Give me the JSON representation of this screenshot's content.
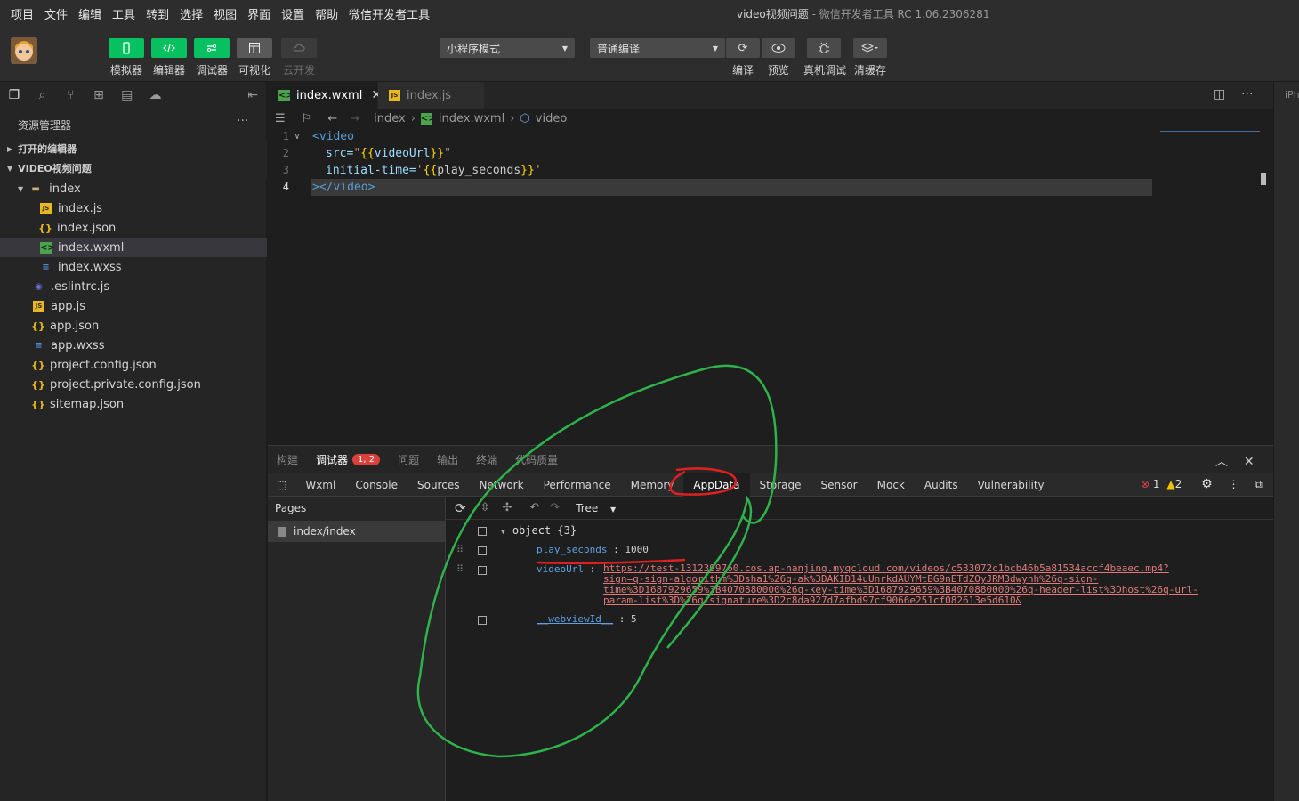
{
  "menu": [
    "项目",
    "文件",
    "编辑",
    "工具",
    "转到",
    "选择",
    "视图",
    "界面",
    "设置",
    "帮助",
    "微信开发者工具"
  ],
  "window_title": {
    "main": "video视频问题",
    "suffix": " - 微信开发者工具 RC 1.06.2306281"
  },
  "toolbar": {
    "simulator": "模拟器",
    "editor": "编辑器",
    "debugger": "调试器",
    "visual": "可视化",
    "cloud": "云开发",
    "mode_select": "小程序模式",
    "compile_select": "普通编译",
    "compile": "编译",
    "preview": "预览",
    "remote_debug": "真机调试",
    "clear_cache": "清缓存"
  },
  "sidebar": {
    "title": "资源管理器",
    "open_editors": "打开的编辑器",
    "project": "VIDEO视频问题",
    "files": [
      {
        "name": "index",
        "type": "folder"
      },
      {
        "name": "index.js",
        "type": "js"
      },
      {
        "name": "index.json",
        "type": "json"
      },
      {
        "name": "index.wxml",
        "type": "wxml"
      },
      {
        "name": "index.wxss",
        "type": "wxss"
      },
      {
        "name": ".eslintrc.js",
        "type": "lint"
      },
      {
        "name": "app.js",
        "type": "js"
      },
      {
        "name": "app.json",
        "type": "json"
      },
      {
        "name": "app.wxss",
        "type": "wxss"
      },
      {
        "name": "project.config.json",
        "type": "json"
      },
      {
        "name": "project.private.config.json",
        "type": "json"
      },
      {
        "name": "sitemap.json",
        "type": "json"
      }
    ]
  },
  "tabs": [
    {
      "label": "index.wxml",
      "active": true
    },
    {
      "label": "index.js",
      "active": false
    }
  ],
  "right_strip": "iPho",
  "breadcrumb": [
    "index",
    "index.wxml",
    "video"
  ],
  "code": {
    "line_numbers": [
      "1",
      "2",
      "3",
      "4"
    ],
    "l1_tag": "<video",
    "l2_attr": "src=",
    "l2_q1": "\"",
    "l2_open": "{{",
    "l2_var": "videoUrl",
    "l2_close": "}}",
    "l2_q2": "\"",
    "l3_attr": "initial-time=",
    "l3_q1": "'",
    "l3_open": "{{",
    "l3_var": "play_seconds",
    "l3_close": "}}",
    "l3_q2": "'",
    "l4_gt": ">",
    "l4_close": "</video>"
  },
  "debug_tabs": [
    "构建",
    "调试器",
    "问题",
    "输出",
    "终端",
    "代码质量"
  ],
  "debug_badge": "1, 2",
  "dev_tabs": [
    "Wxml",
    "Console",
    "Sources",
    "Network",
    "Performance",
    "Memory",
    "AppData",
    "Storage",
    "Sensor",
    "Mock",
    "Audits",
    "Vulnerability"
  ],
  "dev_status": {
    "errors": "1",
    "warnings": "2"
  },
  "pages": {
    "title": "Pages",
    "item": "index/index"
  },
  "appdata": {
    "view": "Tree",
    "root": "object {3}",
    "k1": "play_seconds",
    "v1": "1000",
    "k2": "videoUrl",
    "url1": "https://test-1312399760.cos.ap-nanjing.myqcloud.com/videos/c533072c1bcb46b5a81534accf4beaec.mp4?",
    "url2": "sign=q-sign-algorithm%3Dsha1%26q-ak%3DAKID14uUnrkdAUYMtBG9nETdZOyJRM3dwynh%26q-sign-",
    "url3": "time%3D1687929659%3B4070880000%26q-key-time%3D1687929659%3B4070880000%26q-header-list%3Dhost%26q-url-",
    "url4": "param-list%3D%26q-signature%3D2c8da927d7afbd97cf9066e251cf082613e5d610&",
    "k3": "__webviewId__",
    "v3": "5"
  },
  "colors": {
    "accent": "#07c160",
    "annotation_green": "#2db34a",
    "annotation_red": "#e02020"
  }
}
